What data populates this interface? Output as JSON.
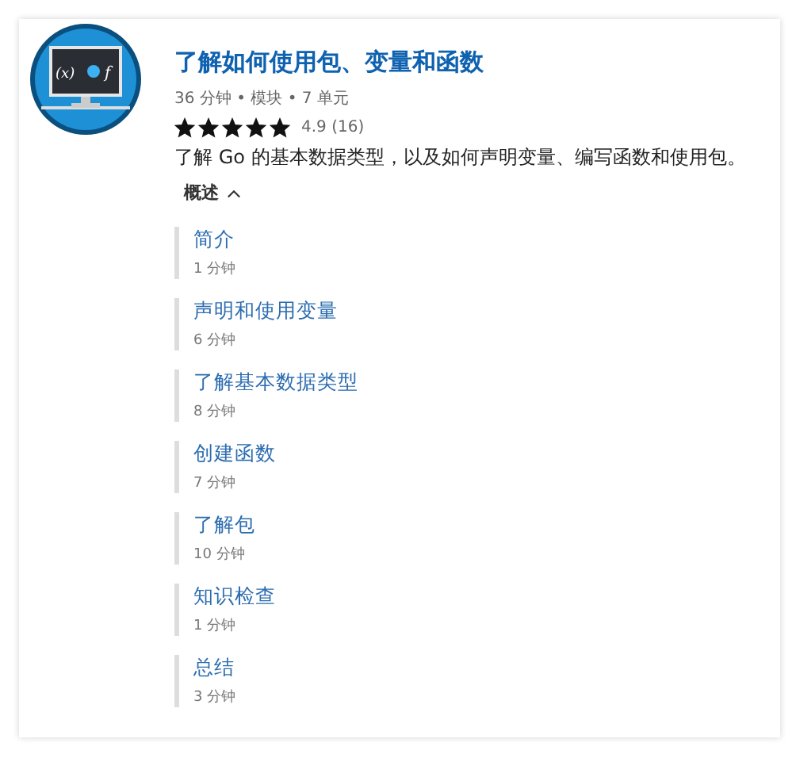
{
  "module": {
    "icon_left": "(x)",
    "icon_right": "f",
    "title": "了解如何使用包、变量和函数",
    "meta": "36 分钟 • 模块 • 7 单元",
    "stars": 5,
    "rating": "4.9 (16)",
    "description": "了解 Go 的基本数据类型，以及如何声明变量、编写函数和使用包。",
    "overview": {
      "label": "概述",
      "expanded": true
    }
  },
  "units": [
    {
      "title": "简介",
      "duration": "1 分钟"
    },
    {
      "title": "声明和使用变量",
      "duration": "6 分钟"
    },
    {
      "title": "了解基本数据类型",
      "duration": "8 分钟"
    },
    {
      "title": "创建函数",
      "duration": "7 分钟"
    },
    {
      "title": "了解包",
      "duration": "10 分钟"
    },
    {
      "title": "知识检查",
      "duration": "1 分钟"
    },
    {
      "title": "总结",
      "duration": "3 分钟"
    }
  ]
}
